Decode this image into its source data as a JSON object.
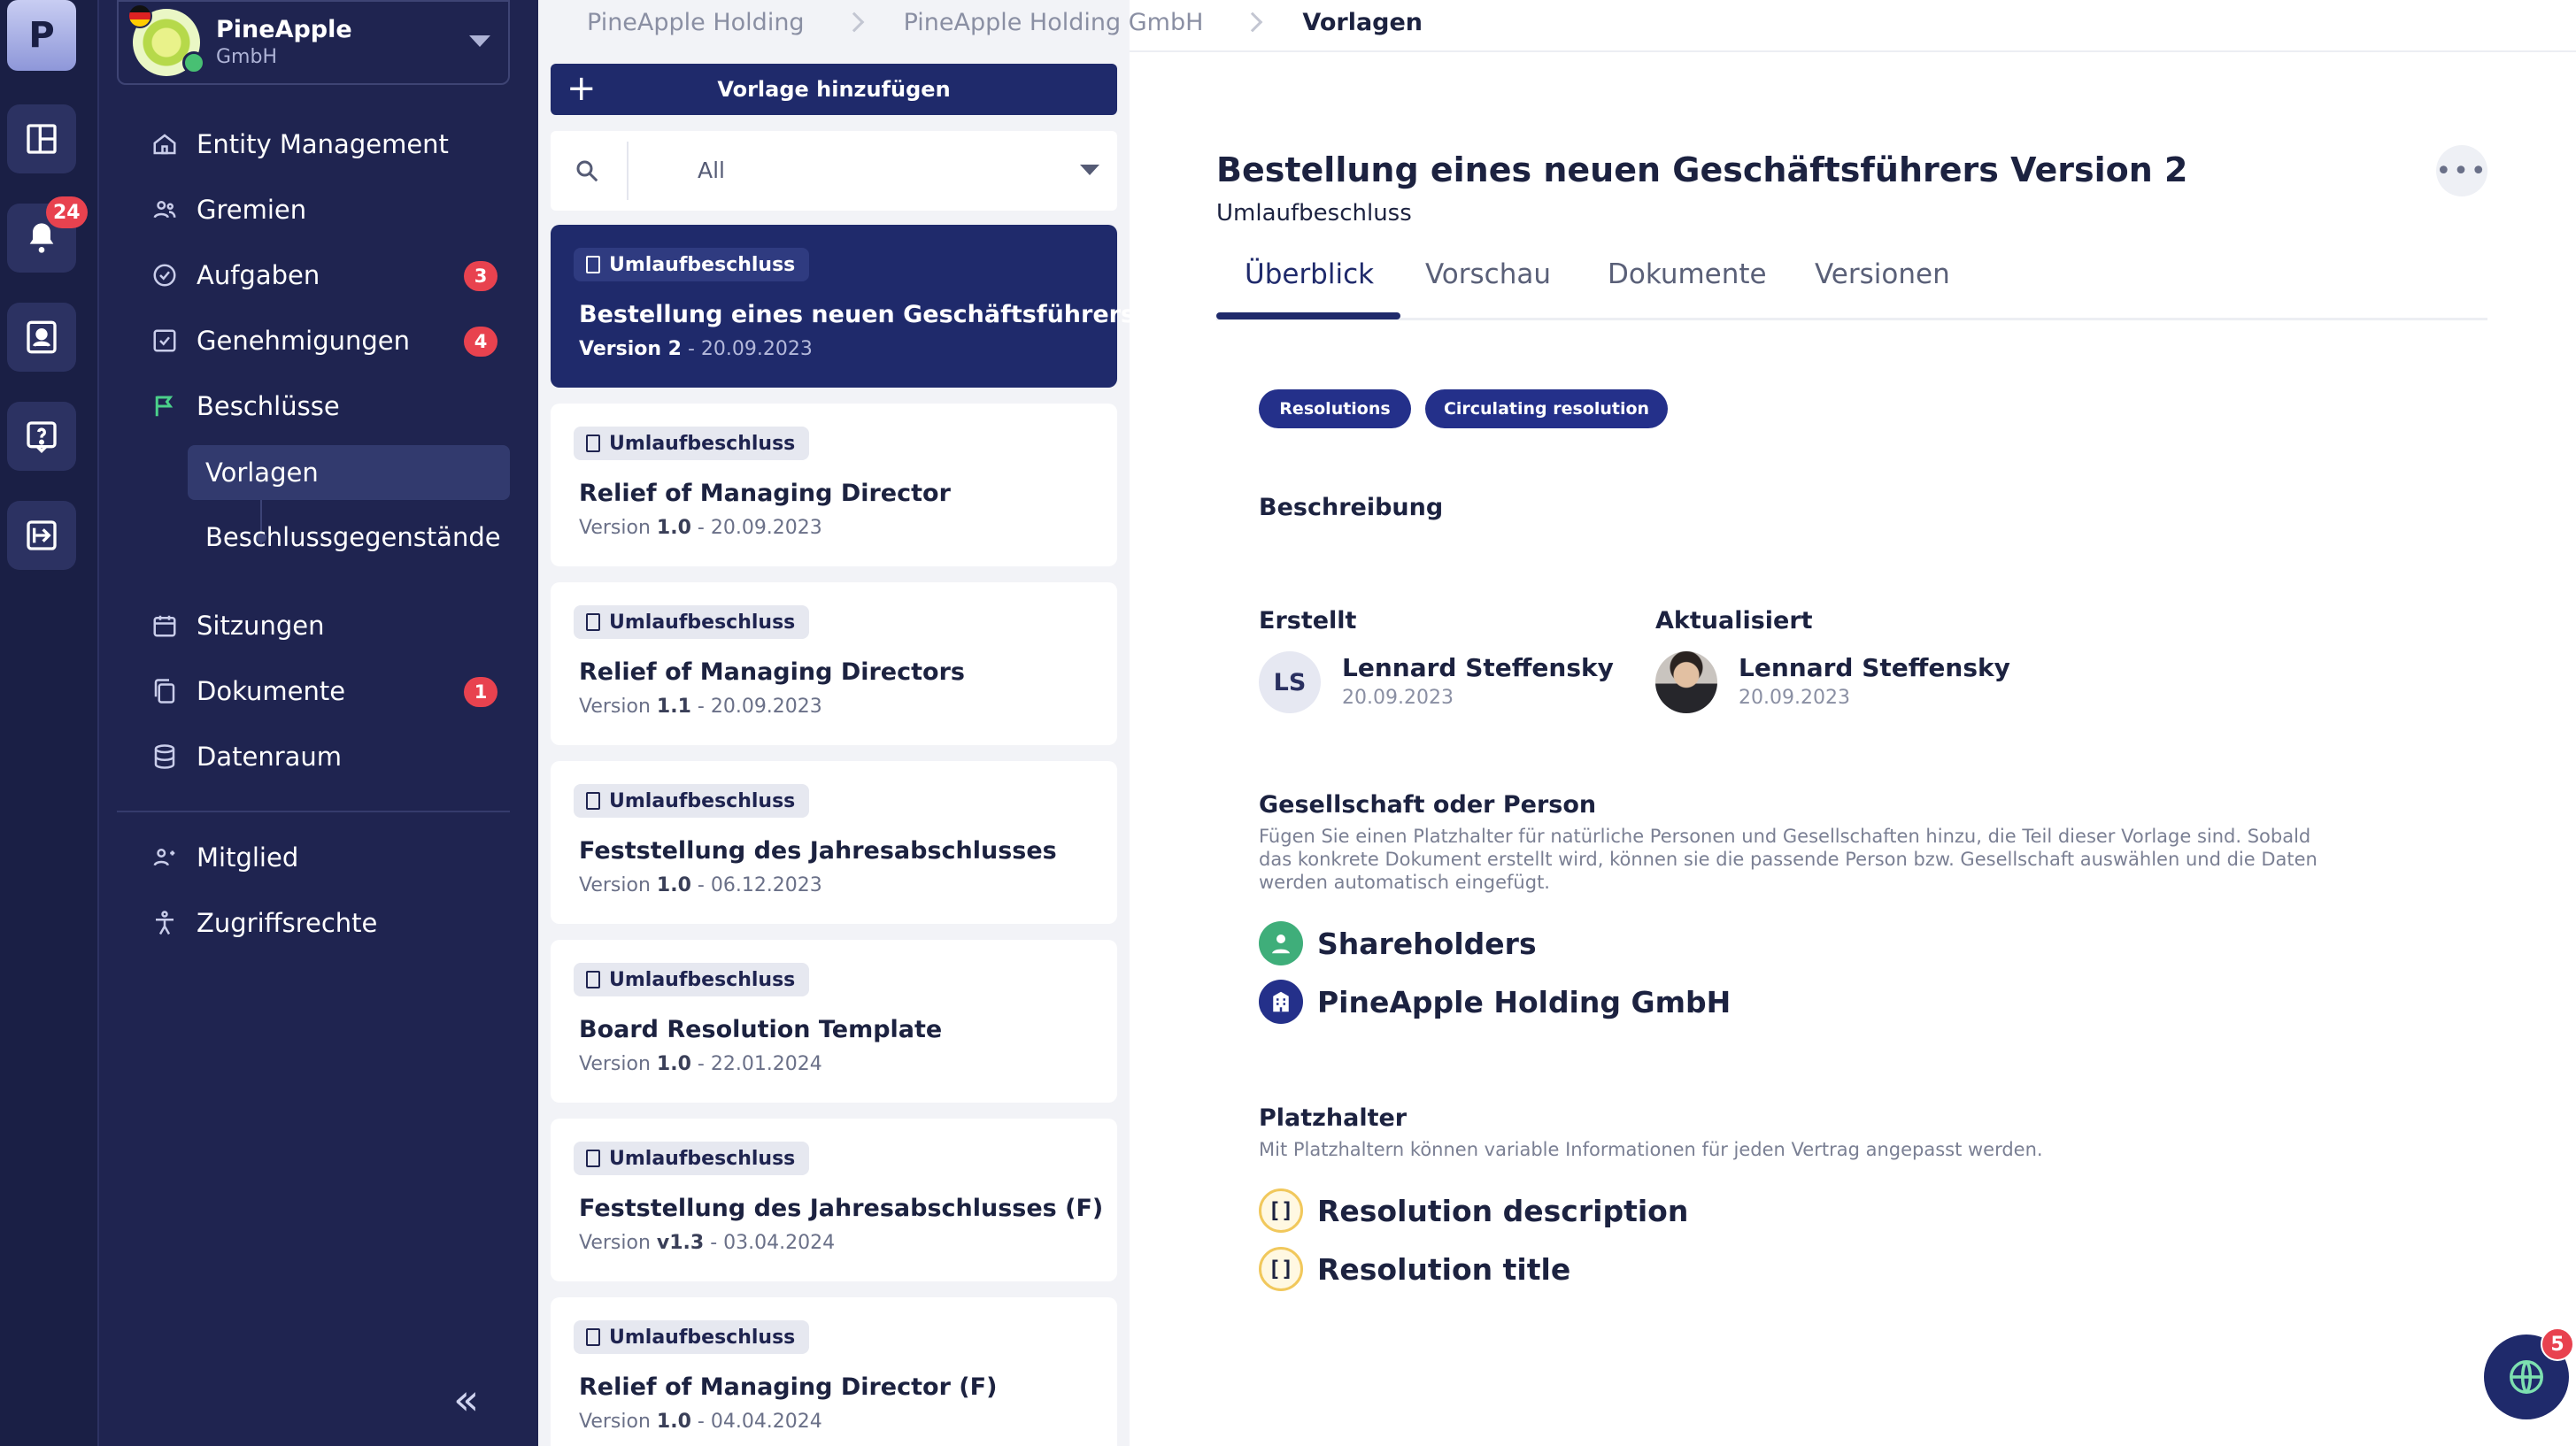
{
  "rail": {
    "logo_letter": "P",
    "notification_count": "24"
  },
  "org": {
    "name": "PineApple",
    "subtitle": "GmbH"
  },
  "nav": {
    "items": [
      {
        "label": "Entity Management",
        "icon": "home-icon"
      },
      {
        "label": "Gremien",
        "icon": "users-icon"
      },
      {
        "label": "Aufgaben",
        "icon": "check-circle-icon",
        "badge": "3"
      },
      {
        "label": "Genehmigungen",
        "icon": "check-square-icon",
        "badge": "4"
      },
      {
        "label": "Beschlüsse",
        "icon": "flag-icon"
      },
      {
        "label": "Vorlagen",
        "icon": "",
        "active": true
      },
      {
        "label": "Beschlussgegenstände",
        "icon": ""
      },
      {
        "label": "Sitzungen",
        "icon": "calendar-icon"
      },
      {
        "label": "Dokumente",
        "icon": "documents-icon",
        "badge": "1"
      },
      {
        "label": "Datenraum",
        "icon": "database-icon"
      },
      {
        "label": "Mitglied",
        "icon": "member-icon"
      },
      {
        "label": "Zugriffsrechte",
        "icon": "access-icon"
      }
    ],
    "collapse_glyph": "«"
  },
  "breadcrumbs": [
    "PineApple Holding",
    "PineApple Holding GmbH",
    "Vorlagen"
  ],
  "list": {
    "add_button": "Vorlage hinzufügen",
    "filter_value": "All",
    "cards": [
      {
        "chip": "Umlaufbeschluss",
        "title": "Bestellung eines neuen Geschäftsführers",
        "version_prefix": "Version",
        "version": "Version 2",
        "date": "20.09.2023"
      },
      {
        "chip": "Umlaufbeschluss",
        "title": "Relief of Managing Director",
        "version_prefix": "Version",
        "version": "1.0",
        "date": "20.09.2023"
      },
      {
        "chip": "Umlaufbeschluss",
        "title": "Relief of Managing Directors",
        "version_prefix": "Version",
        "version": "1.1",
        "date": "20.09.2023"
      },
      {
        "chip": "Umlaufbeschluss",
        "title": "Feststellung des Jahresabschlusses",
        "version_prefix": "Version",
        "version": "1.0",
        "date": "06.12.2023"
      },
      {
        "chip": "Umlaufbeschluss",
        "title": "Board Resolution Template",
        "version_prefix": "Version",
        "version": "1.0",
        "date": "22.01.2024"
      },
      {
        "chip": "Umlaufbeschluss",
        "title": "Feststellung des Jahresabschlusses (F)",
        "version_prefix": "Version",
        "version": "v1.3",
        "date": "03.04.2024"
      },
      {
        "chip": "Umlaufbeschluss",
        "title": "Relief of Managing Director (F)",
        "version_prefix": "Version",
        "version": "1.0",
        "date": "04.04.2024"
      }
    ]
  },
  "detail": {
    "title": "Bestellung eines neuen Geschäftsführers Version 2",
    "subtitle": "Umlaufbeschluss",
    "more_glyph": "•••",
    "tabs": [
      "Überblick",
      "Vorschau",
      "Dokumente",
      "Versionen"
    ],
    "tags": [
      "Resolutions",
      "Circulating resolution"
    ],
    "description_heading": "Beschreibung",
    "created_heading": "Erstellt",
    "updated_heading": "Aktualisiert",
    "created": {
      "initials": "LS",
      "name": "Lennard Steffensky",
      "date": "20.09.2023"
    },
    "updated": {
      "name": "Lennard Steffensky",
      "date": "20.09.2023"
    },
    "entities_heading": "Gesellschaft oder Person",
    "entities_desc": "Fügen Sie einen Platzhalter für natürliche Personen und Gesellschaften hinzu, die Teil dieser Vorlage sind. Sobald das konkrete Dokument erstellt wird, können sie die passende Person bzw. Gesellschaft auswählen und die Daten werden automatisch eingefügt.",
    "entities": [
      {
        "label": "Shareholders",
        "icon": "person-icon",
        "color": "#3fae7a"
      },
      {
        "label": "PineApple Holding GmbH",
        "icon": "building-icon",
        "color": "#24308a"
      }
    ],
    "placeholders_heading": "Platzhalter",
    "placeholders_desc": "Mit Platzhaltern können variable Informationen für jeden Vertrag angepasst werden.",
    "placeholders": [
      {
        "glyph": "[]",
        "label": "Resolution description"
      },
      {
        "glyph": "[]",
        "label": "Resolution title"
      }
    ]
  },
  "chat": {
    "badge": "5"
  },
  "colors": {
    "rail_bg": "#1a1f45",
    "nav_bg": "#1f2450",
    "primary": "#1f2a6b",
    "badge": "#e8424f",
    "active_accent": "#4bd08a"
  }
}
